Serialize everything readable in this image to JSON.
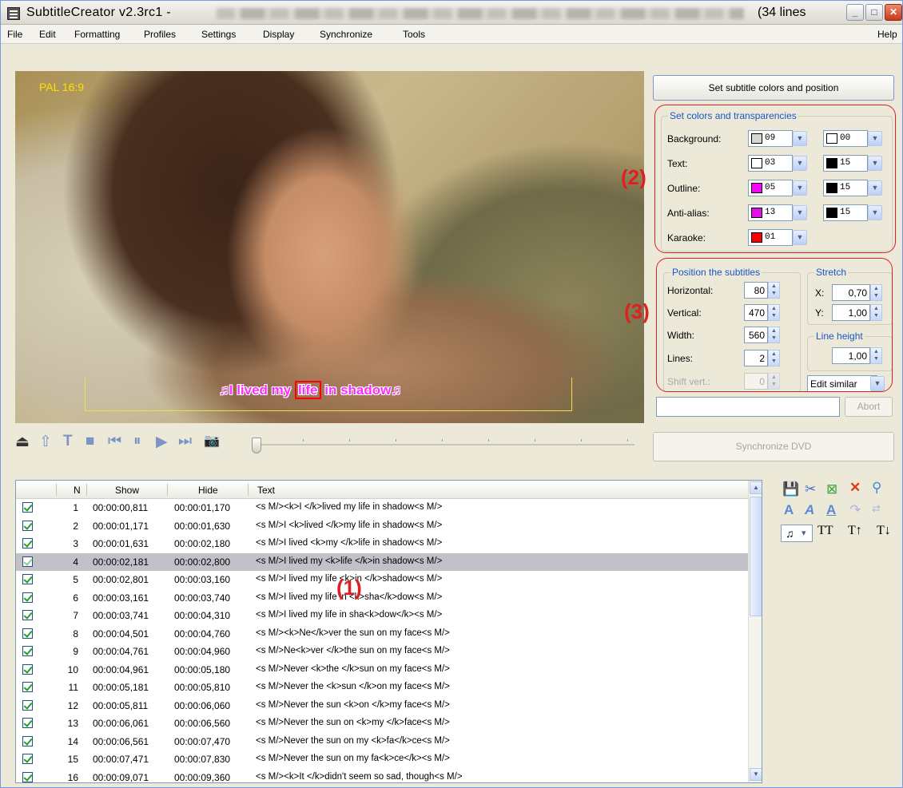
{
  "window": {
    "title": "SubtitleCreator v2.3rc1 -",
    "title_suffix": "(34 lines",
    "controls": {
      "minimize": "_",
      "maximize": "□",
      "close": "✕"
    }
  },
  "menu": [
    {
      "label": "File",
      "accel": "F"
    },
    {
      "label": "Edit",
      "accel": "E"
    },
    {
      "label": "Formatting",
      "accel": "o"
    },
    {
      "label": "Profiles",
      "accel": "P"
    },
    {
      "label": "Settings",
      "accel": "S"
    },
    {
      "label": "Display",
      "accel": "D"
    },
    {
      "label": "Synchronize",
      "accel": "y"
    },
    {
      "label": "Tools",
      "accel": "T"
    },
    {
      "label": "Help",
      "accel": "H"
    }
  ],
  "video": {
    "format_label": "PAL 16:9",
    "subtitle_before": "♫I lived my ",
    "subtitle_karaoke": "life",
    "subtitle_after": " in shadow♫"
  },
  "player": {
    "eject": "⏏",
    "home": "⇧",
    "text": "T",
    "stop": "■",
    "prev": "⏮",
    "pause": "⏸",
    "play": "▶",
    "next": "⏭",
    "snapshot": "📷",
    "position_fraction": 0.0
  },
  "panel": {
    "set_colors_button": "Set subtitle colors and position",
    "colors_group": "Set colors and transparencies",
    "color_rows": [
      {
        "label": "Background:",
        "a_color": "#d8d6d0",
        "a_val": "09",
        "b_color": "#ffffff",
        "b_val": "00"
      },
      {
        "label": "Text:",
        "a_color": "#ffffff",
        "a_val": "03",
        "b_color": "#000000",
        "b_val": "15"
      },
      {
        "label": "Outline:",
        "a_color": "#ff00ff",
        "a_val": "05",
        "b_color": "#000000",
        "b_val": "15"
      },
      {
        "label": "Anti-alias:",
        "a_color": "#e011e8",
        "a_val": "13",
        "b_color": "#000000",
        "b_val": "15"
      },
      {
        "label": "Karaoke:",
        "a_color": "#ff0000",
        "a_val": "01"
      }
    ],
    "position_group": "Position the subtitles",
    "position": [
      {
        "label": "Horizontal:",
        "value": "80"
      },
      {
        "label": "Vertical:",
        "value": "470"
      },
      {
        "label": "Width:",
        "value": "560"
      },
      {
        "label": "Lines:",
        "value": "2"
      },
      {
        "label": "Shift vert.:",
        "value": "0"
      }
    ],
    "stretch_group": "Stretch",
    "stretch_x_label": "X:",
    "stretch_x": "0,70",
    "stretch_y_label": "Y:",
    "stretch_y": "1,00",
    "line_height_group": "Line height",
    "line_height": "1,00",
    "edit_mode": "Edit similar",
    "abort_button": "Abort",
    "sync_button": "Synchronize DVD",
    "annotation_2": "(2)",
    "annotation_3": "(3)"
  },
  "list": {
    "columns": {
      "n": "N",
      "show": "Show",
      "hide": "Hide",
      "text": "Text"
    },
    "annotation_1": "(1)",
    "rows": [
      {
        "n": "1",
        "show": "00:00:00,811",
        "hide": "00:00:01,170",
        "text": "<s M/><k>I </k>lived my life in shadow<s M/>"
      },
      {
        "n": "2",
        "show": "00:00:01,171",
        "hide": "00:00:01,630",
        "text": "<s M/>I <k>lived </k>my life in shadow<s M/>"
      },
      {
        "n": "3",
        "show": "00:00:01,631",
        "hide": "00:00:02,180",
        "text": "<s M/>I lived <k>my </k>life in shadow<s M/>"
      },
      {
        "n": "4",
        "show": "00:00:02,181",
        "hide": "00:00:02,800",
        "text": "<s M/>I lived my <k>life </k>in shadow<s M/>"
      },
      {
        "n": "5",
        "show": "00:00:02,801",
        "hide": "00:00:03,160",
        "text": "<s M/>I lived my life <k>in </k>shadow<s M/>"
      },
      {
        "n": "6",
        "show": "00:00:03,161",
        "hide": "00:00:03,740",
        "text": "<s M/>I lived my life in <k>sha</k>dow<s M/>"
      },
      {
        "n": "7",
        "show": "00:00:03,741",
        "hide": "00:00:04,310",
        "text": "<s M/>I lived my life in sha<k>dow</k><s M/>"
      },
      {
        "n": "8",
        "show": "00:00:04,501",
        "hide": "00:00:04,760",
        "text": "<s M/><k>Ne</k>ver the sun on my face<s M/>"
      },
      {
        "n": "9",
        "show": "00:00:04,761",
        "hide": "00:00:04,960",
        "text": "<s M/>Ne<k>ver </k>the sun on my face<s M/>"
      },
      {
        "n": "10",
        "show": "00:00:04,961",
        "hide": "00:00:05,180",
        "text": "<s M/>Never <k>the </k>sun on my face<s M/>"
      },
      {
        "n": "11",
        "show": "00:00:05,181",
        "hide": "00:00:05,810",
        "text": "<s M/>Never the <k>sun </k>on my face<s M/>"
      },
      {
        "n": "12",
        "show": "00:00:05,811",
        "hide": "00:00:06,060",
        "text": "<s M/>Never the sun <k>on </k>my face<s M/>"
      },
      {
        "n": "13",
        "show": "00:00:06,061",
        "hide": "00:00:06,560",
        "text": "<s M/>Never the sun on <k>my </k>face<s M/>"
      },
      {
        "n": "14",
        "show": "00:00:06,561",
        "hide": "00:00:07,470",
        "text": "<s M/>Never the sun on my <k>fa</k>ce<s M/>"
      },
      {
        "n": "15",
        "show": "00:00:07,471",
        "hide": "00:00:07,830",
        "text": "<s M/>Never the sun on my fa<k>ce</k><s M/>"
      },
      {
        "n": "16",
        "show": "00:00:09,071",
        "hide": "00:00:09,360",
        "text": "<s M/><k>It </k>didn't seem so sad, though<s M/>"
      }
    ],
    "selected_row": 4
  },
  "toolbar": {
    "save_icon": "💾",
    "cut_icon": "✂",
    "merge_icon": "⊠",
    "delete_icon": "✕",
    "find_icon": "⚲",
    "font_a": "A",
    "font_italic_a": "A",
    "font_underline_a": "A",
    "rotate_icon": "↷",
    "spacing_icon": "⇄",
    "note_icon": "♫",
    "dropdown": "▾",
    "case_toggle": "TT",
    "case_up": "T↑",
    "case_down": "T↓"
  }
}
